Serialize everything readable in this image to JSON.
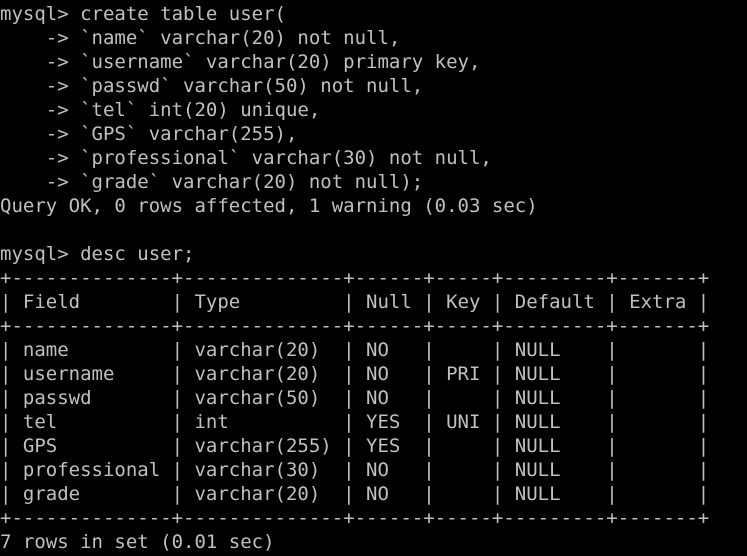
{
  "terminal": {
    "lines": [
      "mysql> create table user(",
      "    -> `name` varchar(20) not null,",
      "    -> `username` varchar(20) primary key,",
      "    -> `passwd` varchar(50) not null,",
      "    -> `tel` int(20) unique,",
      "    -> `GPS` varchar(255),",
      "    -> `professional` varchar(30) not null,",
      "    -> `grade` varchar(20) not null);",
      "Query OK, 0 rows affected, 1 warning (0.03 sec)",
      "",
      "mysql> desc user;",
      "+--------------+--------------+------+-----+---------+-------+",
      "| Field        | Type         | Null | Key | Default | Extra |",
      "+--------------+--------------+------+-----+---------+-------+",
      "| name         | varchar(20)  | NO   |     | NULL    |       |",
      "| username     | varchar(20)  | NO   | PRI | NULL    |       |",
      "| passwd       | varchar(50)  | NO   |     | NULL    |       |",
      "| tel          | int          | YES  | UNI | NULL    |       |",
      "| GPS          | varchar(255) | YES  |     | NULL    |       |",
      "| professional | varchar(30)  | NO   |     | NULL    |       |",
      "| grade        | varchar(20)  | NO   |     | NULL    |       |",
      "+--------------+--------------+------+-----+---------+-------+",
      "7 rows in set (0.01 sec)"
    ],
    "colors": {
      "background": "#000000",
      "text": "#c0c0c0"
    }
  }
}
